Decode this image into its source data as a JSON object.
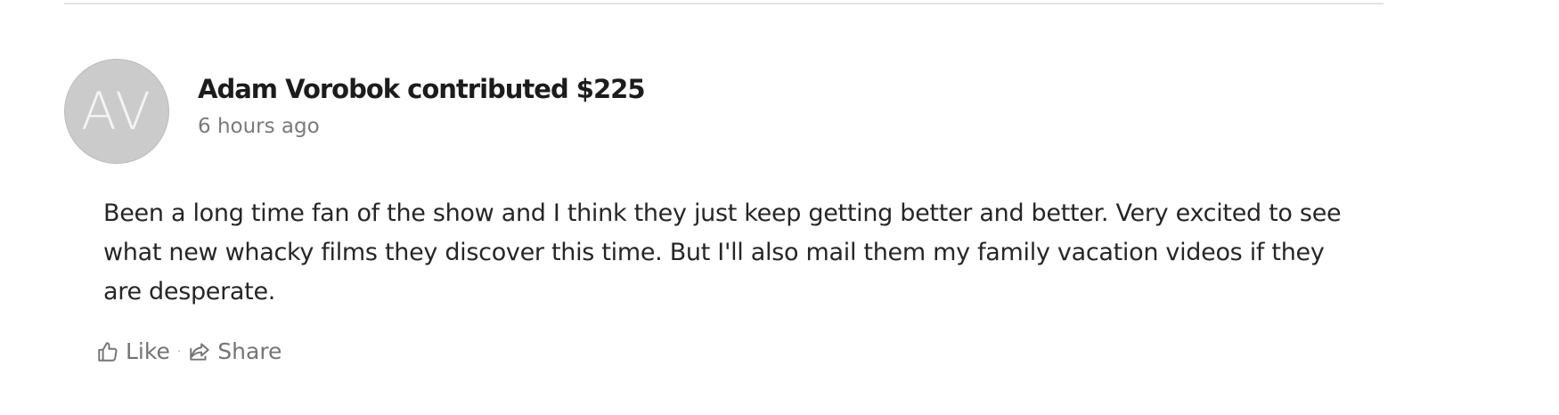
{
  "contribution": {
    "avatar_initials": "AV",
    "title": "Adam Vorobok contributed $225",
    "time": "6 hours ago",
    "comment": "Been a long time fan of the show and I think they just keep getting better and better. Very excited to see what new whacky films they discover this time. But I'll also mail them my family vacation videos if they are desperate.",
    "actions": {
      "like_label": "Like",
      "separator": "·",
      "share_label": "Share"
    }
  },
  "icons": {
    "like": "thumbs-up-icon",
    "share": "share-icon"
  },
  "colors": {
    "avatar_bg": "#cbcbcb",
    "title_text": "#1c1c1c",
    "muted_text": "#7a7a7a",
    "divider": "#e3e3e3"
  }
}
